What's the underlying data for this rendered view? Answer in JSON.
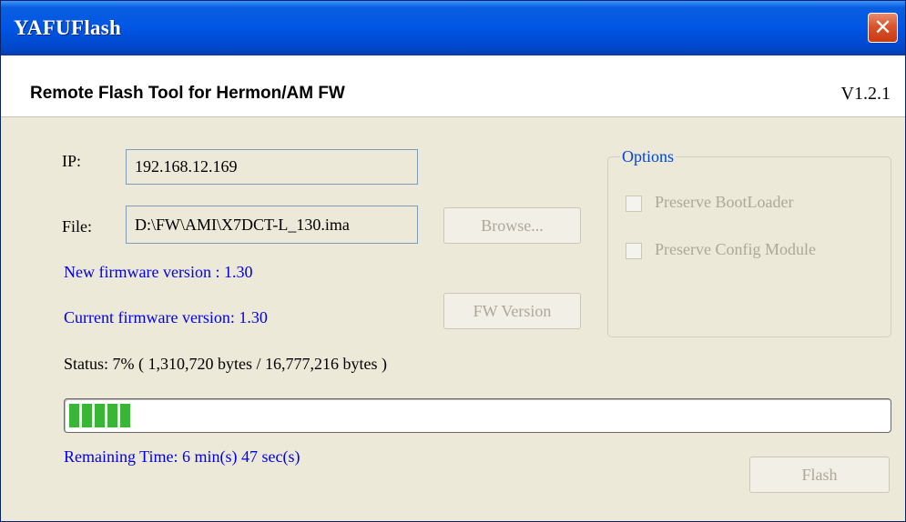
{
  "window": {
    "title": "YAFUFlash",
    "close_icon": "close-icon",
    "close_color": "#d9542b"
  },
  "header": {
    "title": "Remote Flash Tool for Hermon/AM FW",
    "version": "V1.2.1"
  },
  "form": {
    "ip_label": "IP:",
    "ip_value": "192.168.12.169",
    "file_label": "File:",
    "file_value": "D:\\FW\\AMI\\X7DCT-L_130.ima",
    "browse_label": "Browse...",
    "new_fw_text": "New firmware version : 1.30",
    "current_fw_text": "Current firmware version: 1.30",
    "fw_version_button": "FW Version"
  },
  "options": {
    "title": "Options",
    "preserve_bootloader": "Preserve BootLoader",
    "preserve_config": "Preserve Config Module",
    "preserve_bootloader_checked": false,
    "preserve_config_checked": false
  },
  "status": {
    "text": "Status: 7% ( 1,310,720 bytes / 16,777,216 bytes )",
    "progress_fraction": 0.07,
    "progress_color": "#39b636",
    "remaining_text": "Remaining Time: 6 min(s) 47 sec(s)"
  },
  "actions": {
    "flash_label": "Flash"
  }
}
